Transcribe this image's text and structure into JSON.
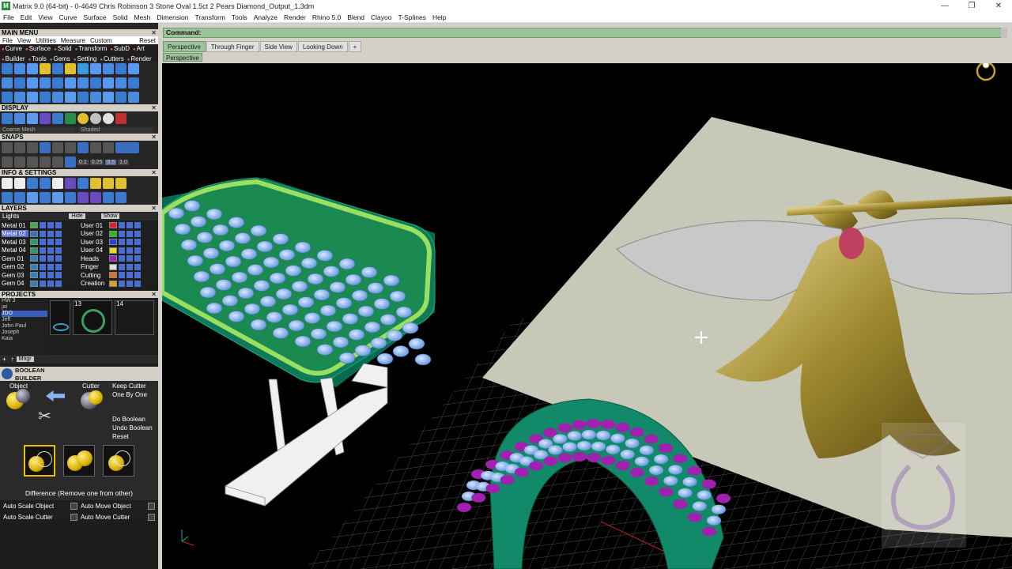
{
  "window": {
    "title": "Matrix 9.0 (64-bit) - 0-4649 Chris Robinson 3 Stone Oval 1.5ct 2 Pears Diamond_Output_1.3dm",
    "app_icon": "M",
    "buttons": [
      "—",
      "❐",
      "✕"
    ]
  },
  "menubar": [
    "File",
    "Edit",
    "View",
    "Curve",
    "Surface",
    "Solid",
    "Mesh",
    "Dimension",
    "Transform",
    "Tools",
    "Analyze",
    "Render",
    "Rhino 5.0",
    "Blend",
    "Clayoo",
    "T-Splines",
    "Help"
  ],
  "left": {
    "main_menu": {
      "header": "MAIN MENU",
      "menu": [
        "File",
        "View",
        "Utilities",
        "Measure",
        "Custom"
      ],
      "reset": "Reset",
      "items": [
        "Curve",
        "Surface",
        "Solid",
        "Transform",
        "SubD",
        "Art",
        "Builder",
        "Tools",
        "Gems",
        "Setting",
        "Cutters",
        "Render"
      ]
    },
    "display": {
      "header": "DISPLAY",
      "mesh": "Coarse Mesh",
      "mode": "Shaded"
    },
    "snaps": {
      "header": "SNAPS",
      "values": [
        "0.1",
        "0.25",
        "0.5",
        "1.0"
      ]
    },
    "info": {
      "header": "INFO & SETTINGS"
    },
    "layers": {
      "header": "LAYERS",
      "lights": "Lights",
      "hide": "Hide",
      "show": "Show",
      "left": [
        {
          "name": "Metal 01",
          "color": "#4aa84a"
        },
        {
          "name": "Metal 02",
          "color": "#3a6ec0"
        },
        {
          "name": "Metal 03",
          "color": "#2a9a6a"
        },
        {
          "name": "Metal 04",
          "color": "#2a9a6a"
        },
        {
          "name": "Gem 01",
          "color": "#2a80c0"
        },
        {
          "name": "Gem 02",
          "color": "#2a80c0"
        },
        {
          "name": "Gem 03",
          "color": "#2a80c0"
        },
        {
          "name": "Gem 04",
          "color": "#2a80c0"
        }
      ],
      "right": [
        {
          "name": "User 01",
          "color": "#e02020"
        },
        {
          "name": "User 02",
          "color": "#20c020"
        },
        {
          "name": "User 03",
          "color": "#2040e0"
        },
        {
          "name": "User 04",
          "color": "#e0e020"
        },
        {
          "name": "Heads",
          "color": "#a020c0"
        },
        {
          "name": "Finger",
          "color": "#e0e0e0"
        },
        {
          "name": "Cutting",
          "color": "#e07020"
        },
        {
          "name": "Creation",
          "color": "#e0a020"
        }
      ]
    },
    "projects": {
      "header": "PROJECTS",
      "names": [
        "HW 3",
        "jai",
        "JDO",
        "Jeff",
        "John Paul",
        "Joseph",
        "Kaia"
      ],
      "thumbs": [
        "13",
        "14"
      ],
      "mngr": "Mngr"
    },
    "boolean": {
      "title_line1": "BOOLEAN",
      "title_line2": "BUILDER",
      "object_label": "Object",
      "cutter_label": "Cutter",
      "keep_cutter": "Keep Cutter",
      "one_by_one": "One By One",
      "do_boolean": "Do Boolean",
      "undo_boolean": "Undo Boolean",
      "reset": "Reset",
      "difference": "Difference (Remove one from other)",
      "auto_scale_object": "Auto Scale Object",
      "auto_move_object": "Auto Move Object",
      "auto_scale_cutter": "Auto Scale Cutter",
      "auto_move_cutter": "Auto Move Cutter"
    }
  },
  "command": {
    "label": "Command:"
  },
  "tabs": [
    "Perspective",
    "Through Finger",
    "Side View",
    "Looking Down",
    "+"
  ],
  "viewport": {
    "name": "Perspective"
  },
  "colors": {
    "command_bar": "#9dc39a",
    "ring_green": "#1a9a70",
    "gem_blue": "#8cb8f0",
    "prong_purple": "#a020b0",
    "grid": "#666666"
  }
}
